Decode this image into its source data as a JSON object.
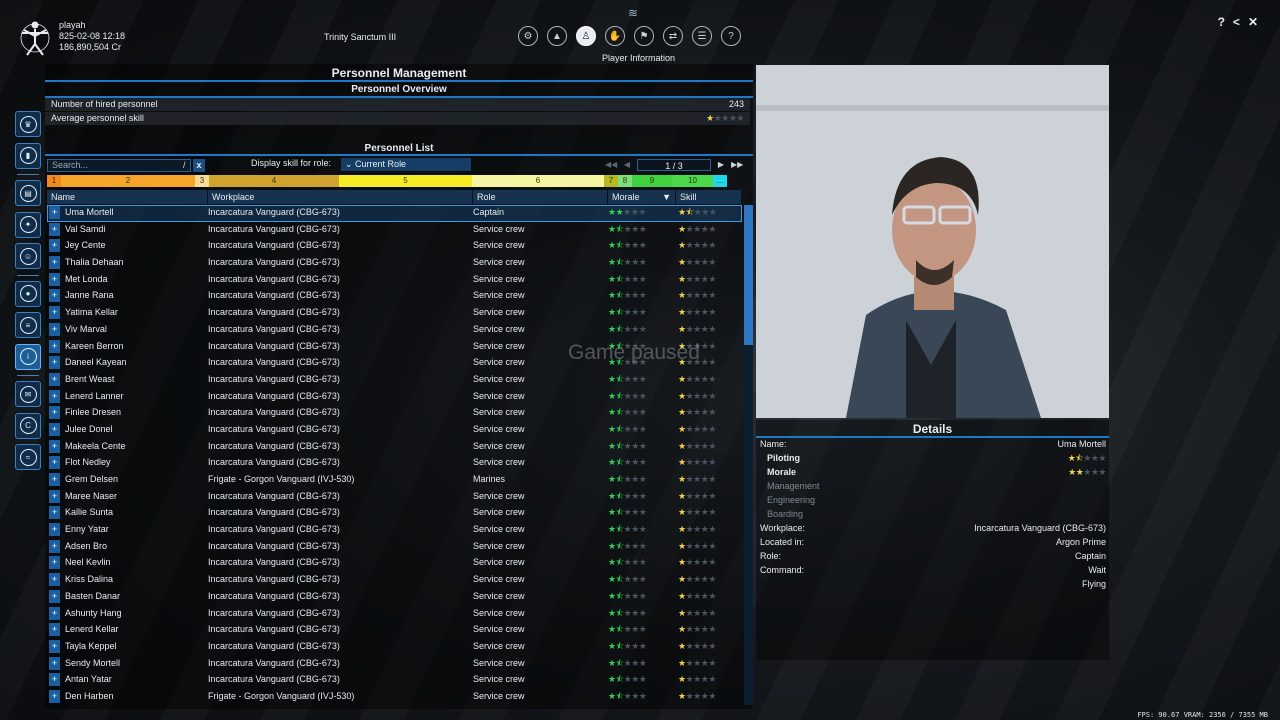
{
  "player": {
    "name": "playah",
    "datetime": "825-02-08 12:18",
    "credits": "186,890,504 Cr",
    "ship": "Trinity Sanctum III"
  },
  "topnav": {
    "caption": "Player Information",
    "buttons": [
      "settings",
      "ship",
      "player-info",
      "handshake",
      "faction",
      "transfer",
      "inventory",
      "help"
    ]
  },
  "window_controls": {
    "help": "?",
    "back": "<",
    "close": "✕"
  },
  "main": {
    "title": "Personnel Management",
    "overview_title": "Personnel Overview",
    "hired_label": "Number of hired personnel",
    "hired_value": "243",
    "avg_label": "Average personnel skill",
    "list_title": "Personnel List",
    "search_placeholder": "Search...",
    "search_slash": "/",
    "search_clear": "x",
    "role_label": "Display skill for role:",
    "role_value": "Current Role",
    "page": "1 / 3",
    "paused": "Game paused"
  },
  "scale": [
    "1",
    "2",
    "3",
    "4",
    "5",
    "6",
    "7",
    "8",
    "9",
    "10",
    "..."
  ],
  "columns": {
    "name": "Name",
    "workplace": "Workplace",
    "role": "Role",
    "morale": "Morale",
    "skill": "Skill"
  },
  "rows": [
    {
      "name": "Uma Mortell",
      "workplace": "Incarcatura Vanguard (CBG-673)",
      "role": "Captain",
      "morale": 2,
      "skill": 1.5
    },
    {
      "name": "Val Samdi",
      "workplace": "Incarcatura Vanguard (CBG-673)",
      "role": "Service crew",
      "morale": 1.5,
      "skill": 1
    },
    {
      "name": "Jey Cente",
      "workplace": "Incarcatura Vanguard (CBG-673)",
      "role": "Service crew",
      "morale": 1.5,
      "skill": 1
    },
    {
      "name": "Thalia Dehaan",
      "workplace": "Incarcatura Vanguard (CBG-673)",
      "role": "Service crew",
      "morale": 1.5,
      "skill": 1
    },
    {
      "name": "Met Londa",
      "workplace": "Incarcatura Vanguard (CBG-673)",
      "role": "Service crew",
      "morale": 1.5,
      "skill": 1
    },
    {
      "name": "Janne Rana",
      "workplace": "Incarcatura Vanguard (CBG-673)",
      "role": "Service crew",
      "morale": 1.5,
      "skill": 1
    },
    {
      "name": "Yatima Kellar",
      "workplace": "Incarcatura Vanguard (CBG-673)",
      "role": "Service crew",
      "morale": 1.5,
      "skill": 1
    },
    {
      "name": "Viv Marval",
      "workplace": "Incarcatura Vanguard (CBG-673)",
      "role": "Service crew",
      "morale": 1.5,
      "skill": 1
    },
    {
      "name": "Kareen Berron",
      "workplace": "Incarcatura Vanguard (CBG-673)",
      "role": "Service crew",
      "morale": 1.5,
      "skill": 1
    },
    {
      "name": "Daneel Kayean",
      "workplace": "Incarcatura Vanguard (CBG-673)",
      "role": "Service crew",
      "morale": 1.5,
      "skill": 1
    },
    {
      "name": "Brent Weast",
      "workplace": "Incarcatura Vanguard (CBG-673)",
      "role": "Service crew",
      "morale": 1.5,
      "skill": 1
    },
    {
      "name": "Lenerd Lanner",
      "workplace": "Incarcatura Vanguard (CBG-673)",
      "role": "Service crew",
      "morale": 1.5,
      "skill": 1
    },
    {
      "name": "Finlee Dresen",
      "workplace": "Incarcatura Vanguard (CBG-673)",
      "role": "Service crew",
      "morale": 1.5,
      "skill": 1
    },
    {
      "name": "Julee Donel",
      "workplace": "Incarcatura Vanguard (CBG-673)",
      "role": "Service crew",
      "morale": 1.5,
      "skill": 1
    },
    {
      "name": "Makeela Cente",
      "workplace": "Incarcatura Vanguard (CBG-673)",
      "role": "Service crew",
      "morale": 1.5,
      "skill": 1
    },
    {
      "name": "Flot Nedley",
      "workplace": "Incarcatura Vanguard (CBG-673)",
      "role": "Service crew",
      "morale": 1.5,
      "skill": 1
    },
    {
      "name": "Grem Delsen",
      "workplace": "Frigate - Gorgon Vanguard (IVJ-530)",
      "role": "Marines",
      "morale": 1.5,
      "skill": 1
    },
    {
      "name": "Maree Naser",
      "workplace": "Incarcatura Vanguard (CBG-673)",
      "role": "Service crew",
      "morale": 1.5,
      "skill": 1
    },
    {
      "name": "Kallie Sunta",
      "workplace": "Incarcatura Vanguard (CBG-673)",
      "role": "Service crew",
      "morale": 1.5,
      "skill": 1
    },
    {
      "name": "Enny Yatar",
      "workplace": "Incarcatura Vanguard (CBG-673)",
      "role": "Service crew",
      "morale": 1.5,
      "skill": 1
    },
    {
      "name": "Adsen Bro",
      "workplace": "Incarcatura Vanguard (CBG-673)",
      "role": "Service crew",
      "morale": 1.5,
      "skill": 1
    },
    {
      "name": "Neel Kevlin",
      "workplace": "Incarcatura Vanguard (CBG-673)",
      "role": "Service crew",
      "morale": 1.5,
      "skill": 1
    },
    {
      "name": "Kriss Dalina",
      "workplace": "Incarcatura Vanguard (CBG-673)",
      "role": "Service crew",
      "morale": 1.5,
      "skill": 1
    },
    {
      "name": "Basten Danar",
      "workplace": "Incarcatura Vanguard (CBG-673)",
      "role": "Service crew",
      "morale": 1.5,
      "skill": 1
    },
    {
      "name": "Ashunty Hang",
      "workplace": "Incarcatura Vanguard (CBG-673)",
      "role": "Service crew",
      "morale": 1.5,
      "skill": 1
    },
    {
      "name": "Lenerd Kellar",
      "workplace": "Incarcatura Vanguard (CBG-673)",
      "role": "Service crew",
      "morale": 1.5,
      "skill": 1
    },
    {
      "name": "Tayla Keppel",
      "workplace": "Incarcatura Vanguard (CBG-673)",
      "role": "Service crew",
      "morale": 1.5,
      "skill": 1
    },
    {
      "name": "Sendy Mortell",
      "workplace": "Incarcatura Vanguard (CBG-673)",
      "role": "Service crew",
      "morale": 1.5,
      "skill": 1
    },
    {
      "name": "Antan Yatar",
      "workplace": "Incarcatura Vanguard (CBG-673)",
      "role": "Service crew",
      "morale": 1.5,
      "skill": 1
    },
    {
      "name": "Den Harben",
      "workplace": "Frigate - Gorgon Vanguard (IVJ-530)",
      "role": "Service crew",
      "morale": 1.5,
      "skill": 1
    }
  ],
  "details": {
    "title": "Details",
    "name_label": "Name:",
    "name_value": "Uma Mortell",
    "piloting_label": "Piloting",
    "piloting_stars": 1.5,
    "morale_label": "Morale",
    "morale_stars": 2,
    "management_label": "Management",
    "engineering_label": "Engineering",
    "boarding_label": "Boarding",
    "workplace_label": "Workplace:",
    "workplace_value": "Incarcatura Vanguard (CBG-673)",
    "location_label": "Located in:",
    "location_value": "Argon Prime",
    "role_label": "Role:",
    "role_value": "Captain",
    "command_label": "Command:",
    "command_value": "Wait",
    "command_value2": "Flying"
  },
  "footer": {
    "stats": "FPS: 90.67 VRAM: 2356 / 7355 MB"
  },
  "colors": {
    "accent": "#1e78c8",
    "morale_star": "#2ed158",
    "skill_star": "#f2d24b"
  }
}
